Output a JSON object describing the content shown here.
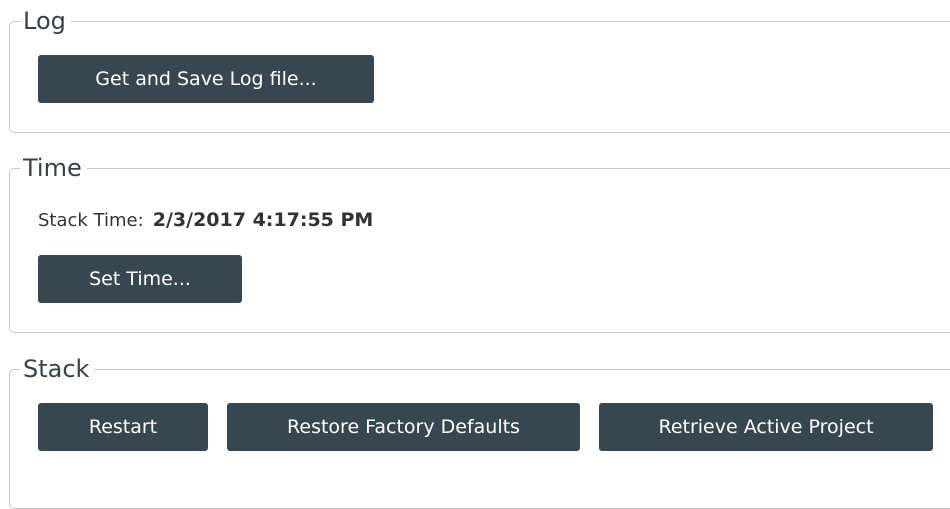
{
  "log": {
    "title": "Log",
    "get_save_log_label": "Get and Save Log file..."
  },
  "time": {
    "title": "Time",
    "stack_time_label": "Stack Time:",
    "stack_time_value": "2/3/2017 4:17:55 PM",
    "set_time_label": "Set Time..."
  },
  "stack": {
    "title": "Stack",
    "restart_label": "Restart",
    "restore_defaults_label": "Restore Factory Defaults",
    "retrieve_project_label": "Retrieve Active Project"
  },
  "colors": {
    "button_bg": "#37474f",
    "button_text": "#ffffff",
    "group_border": "#c8c8c8"
  }
}
